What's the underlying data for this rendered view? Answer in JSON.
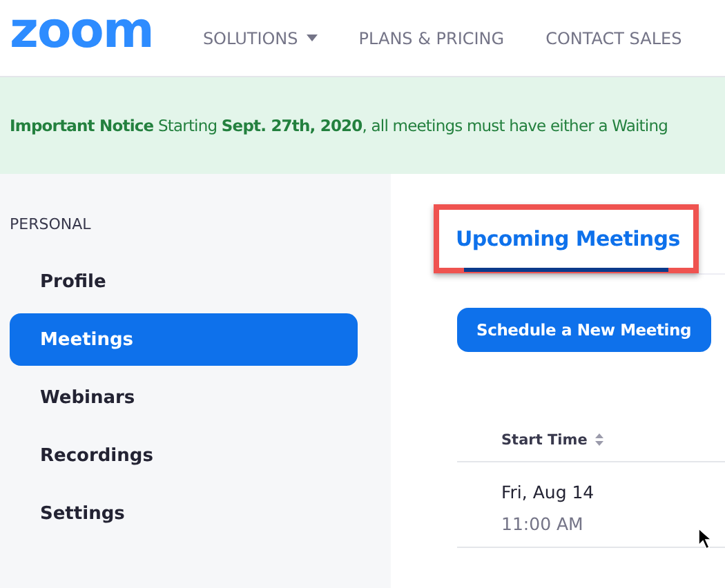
{
  "header": {
    "logo": "zoom",
    "nav": [
      {
        "label": "SOLUTIONS",
        "dropdown": true
      },
      {
        "label": "PLANS & PRICING",
        "dropdown": false
      },
      {
        "label": "CONTACT SALES",
        "dropdown": false
      }
    ]
  },
  "notice": "**Important Notice** Starting **Sept. 27th, 2020**, all meetings must have either a Waiting",
  "sidebar": {
    "section": "PERSONAL",
    "items": [
      {
        "label": "Profile",
        "selected": false
      },
      {
        "label": "Meetings",
        "selected": true
      },
      {
        "label": "Webinars",
        "selected": false
      },
      {
        "label": "Recordings",
        "selected": false
      },
      {
        "label": "Settings",
        "selected": false
      }
    ]
  },
  "tabs": [
    {
      "label": "Upcoming Meetings",
      "selected": true,
      "highlighted": true
    }
  ],
  "schedule_button": "Schedule a New Meeting",
  "table": {
    "columns": [
      {
        "label": "Start Time",
        "sortable": true
      }
    ],
    "rows": [
      {
        "date": "Fri, Aug 14",
        "time": "11:00 AM"
      }
    ]
  }
}
